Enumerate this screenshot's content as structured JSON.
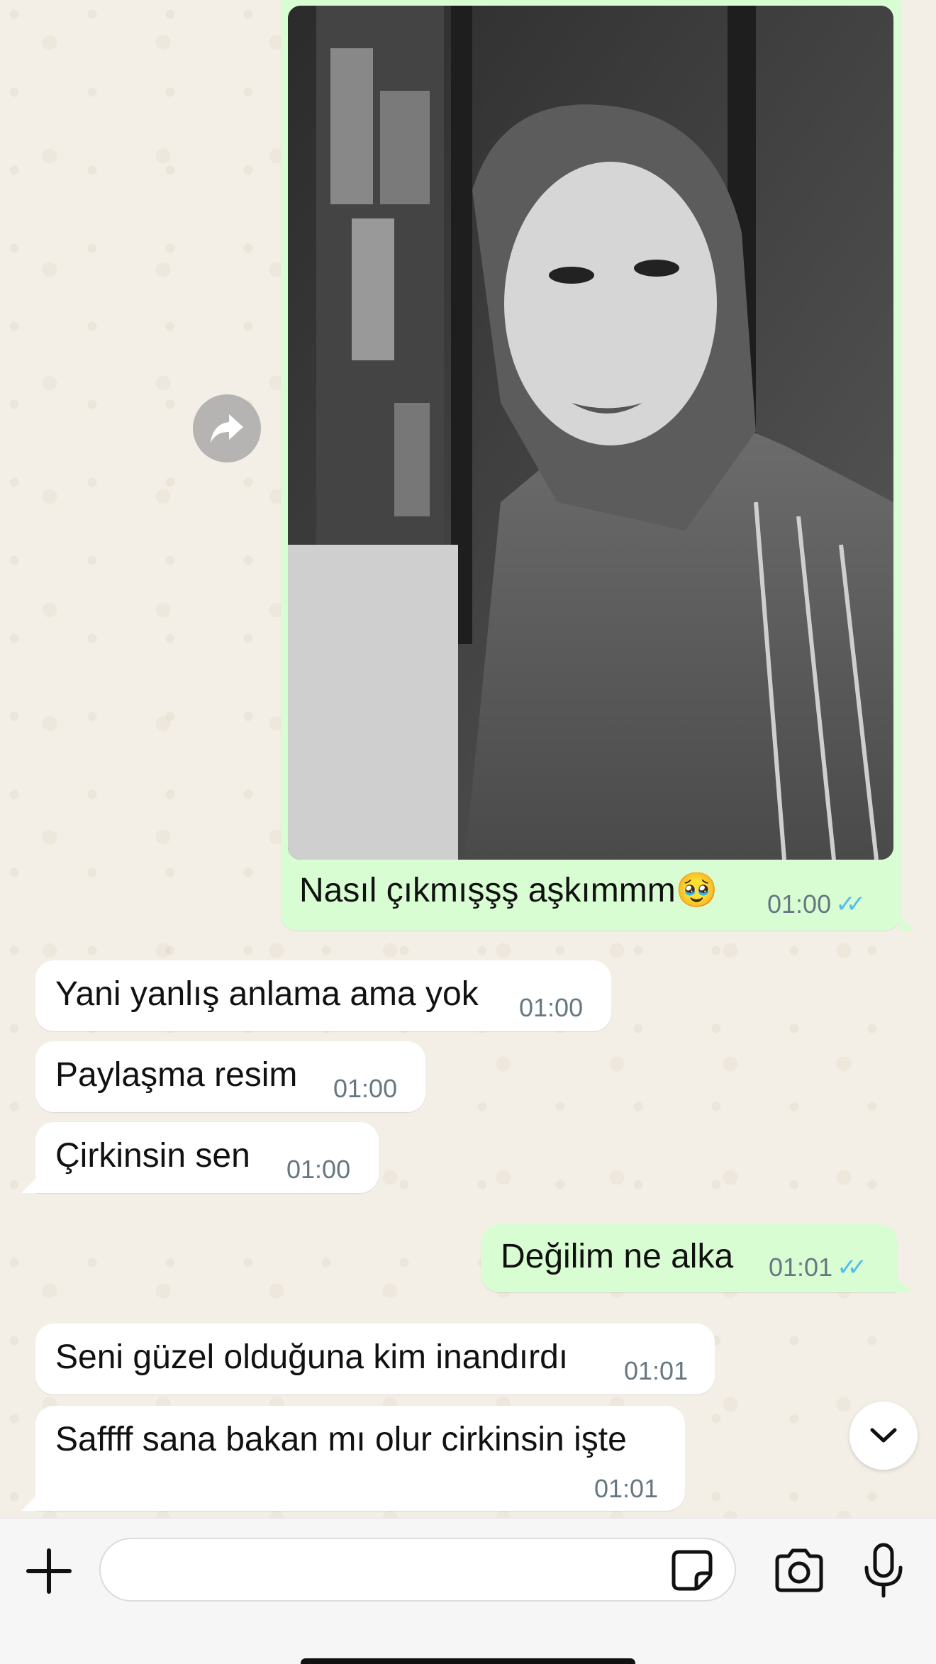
{
  "colors": {
    "outgoing_bubble": "#d9fdd3",
    "incoming_bubble": "#ffffff",
    "read_ticks": "#53bdeb",
    "timestamp": "#667781",
    "chat_background": "#f4efe6"
  },
  "icons": {
    "forward": "forward-icon",
    "read_status": "double-check-icon",
    "scroll": "chevron-down-icon",
    "attach": "plus-icon",
    "sticker": "sticker-icon",
    "camera": "camera-icon",
    "mic": "microphone-icon"
  },
  "messages": [
    {
      "direction": "out",
      "type": "image",
      "caption": "Nasıl çıkmışşş aşkımmm🥹",
      "time": "01:00",
      "status": "read"
    },
    {
      "direction": "in",
      "text": "Yani yanlış anlama ama yok",
      "time": "01:00"
    },
    {
      "direction": "in",
      "text": "Paylaşma resim",
      "time": "01:00"
    },
    {
      "direction": "in",
      "text": "Çirkinsin sen",
      "time": "01:00"
    },
    {
      "direction": "out",
      "text": "Değilim ne alka",
      "time": "01:01",
      "status": "read"
    },
    {
      "direction": "in",
      "text": "Seni güzel olduğuna kim inandırdı",
      "time": "01:01"
    },
    {
      "direction": "in",
      "text": "Saffff sana bakan mı olur cirkinsin işte",
      "time": "01:01"
    }
  ],
  "composer": {
    "value": "",
    "placeholder": ""
  }
}
